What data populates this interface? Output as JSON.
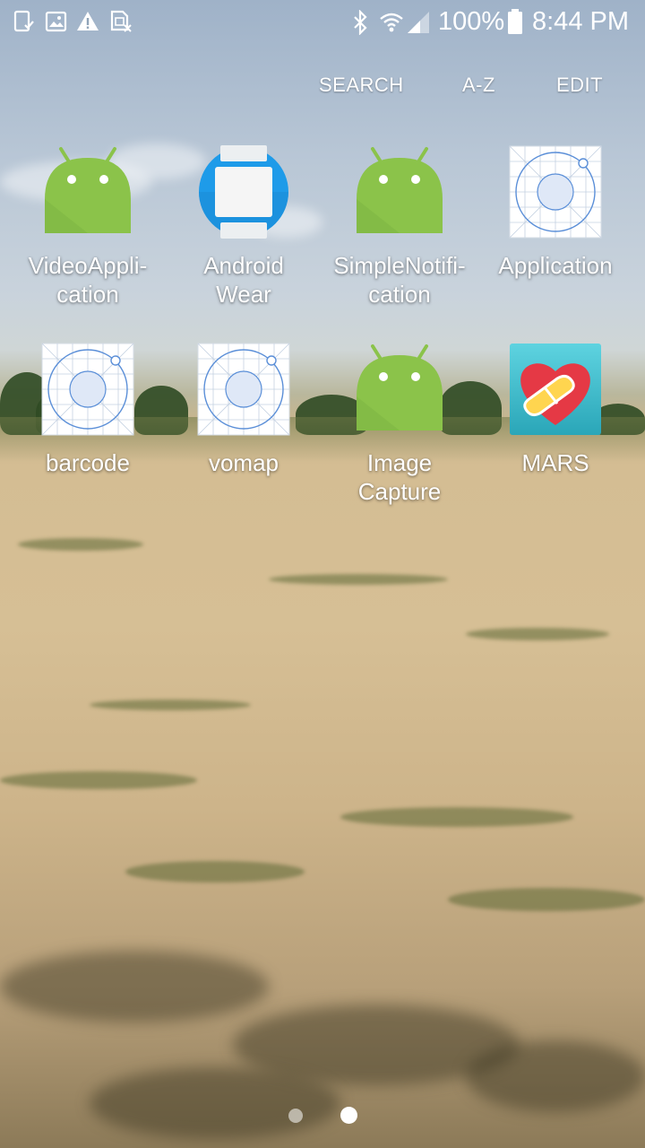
{
  "status_bar": {
    "battery": "100%",
    "time": "8:44 PM",
    "icons": [
      "screenshot-icon",
      "gallery-icon",
      "warning-icon",
      "sim-off-icon",
      "bluetooth-icon",
      "wifi-icon",
      "signal-icon",
      "battery-icon"
    ]
  },
  "toolbar": {
    "search_label": "SEARCH",
    "az_label": "A-Z",
    "edit_label": "EDIT"
  },
  "apps": [
    {
      "label": "VideoAppli-\ncation",
      "icon": "android-robot-icon"
    },
    {
      "label": "Android\nWear",
      "icon": "android-wear-icon"
    },
    {
      "label": "SimpleNotifi-\ncation",
      "icon": "android-robot-icon"
    },
    {
      "label": "Application",
      "icon": "default-app-icon"
    },
    {
      "label": "barcode",
      "icon": "default-app-icon"
    },
    {
      "label": "vomap",
      "icon": "default-app-icon"
    },
    {
      "label": "Image\nCapture",
      "icon": "android-robot-icon"
    },
    {
      "label": "MARS",
      "icon": "heart-pill-icon"
    }
  ],
  "pager": {
    "page_count": 2,
    "current_page": 2
  },
  "colors": {
    "android_green": "#8BC34A",
    "wear_blue": "#1E9BE9",
    "mars_teal": "#3FC1D2"
  }
}
